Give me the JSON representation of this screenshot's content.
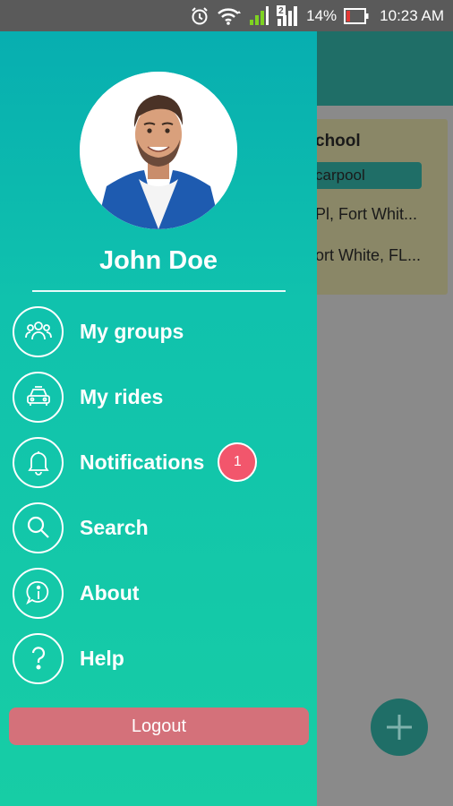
{
  "status_bar": {
    "battery": "14%",
    "time": "10:23 AM",
    "sim": "2",
    "icons": [
      "alarm-icon",
      "wifi-icon",
      "signal-icon",
      "signal-2-icon",
      "battery-icon"
    ]
  },
  "background_card": {
    "title": "chool",
    "tag": "carpool",
    "line1": "Pl, Fort Whit...",
    "line2": "ort White, FL..."
  },
  "drawer": {
    "user_name": "John Doe",
    "menu": [
      {
        "label": "My groups",
        "icon": "groups-icon"
      },
      {
        "label": "My rides",
        "icon": "car-icon"
      },
      {
        "label": "Notifications",
        "icon": "bell-icon",
        "badge": "1"
      },
      {
        "label": "Search",
        "icon": "search-icon"
      },
      {
        "label": "About",
        "icon": "info-icon"
      },
      {
        "label": "Help",
        "icon": "help-icon"
      }
    ],
    "logout_label": "Logout"
  },
  "colors": {
    "drawer_top": "#07aeb0",
    "drawer_bottom": "#17cda5",
    "badge": "#f2566c",
    "logout": "#d4717a",
    "toolbar": "#1f6e67"
  }
}
